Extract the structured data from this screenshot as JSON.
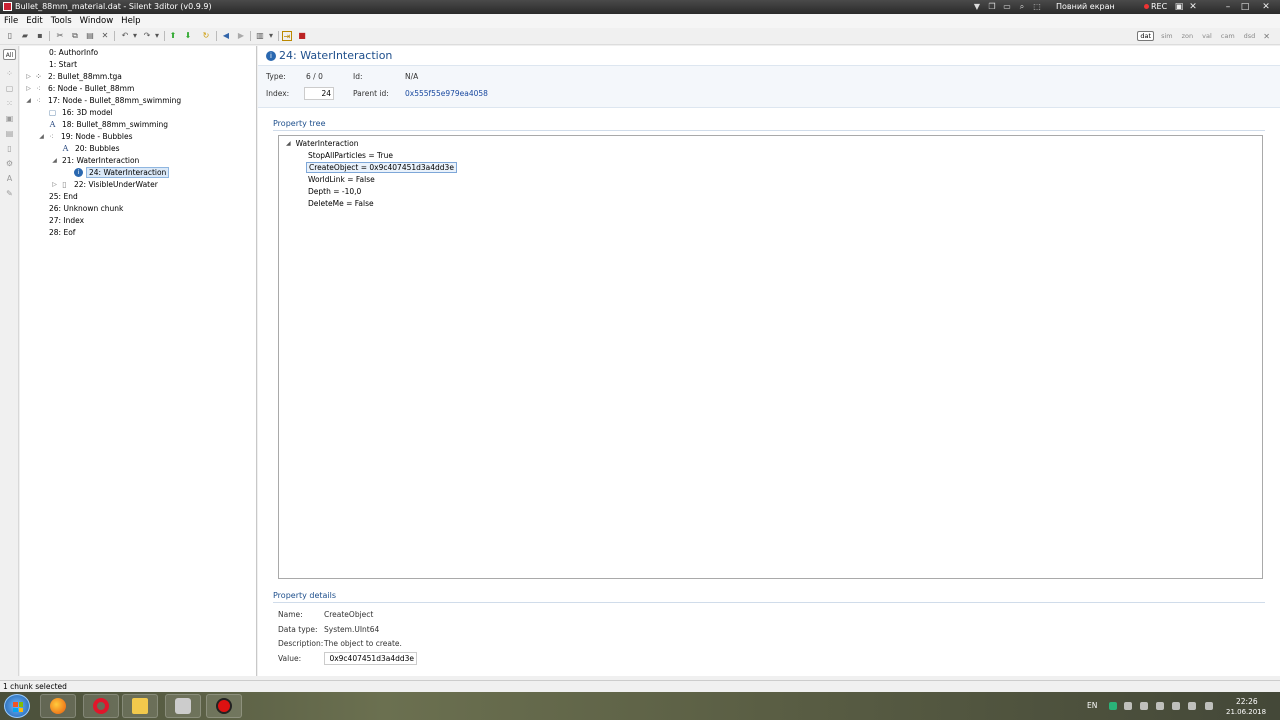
{
  "window": {
    "title": "Bullet_88mm_material.dat - Silent 3ditor (v0.9.9)",
    "fullscreen_label": "Повний екран",
    "rec_label": "REC"
  },
  "menu": [
    "File",
    "Edit",
    "Tools",
    "Window",
    "Help"
  ],
  "view_tabs": [
    {
      "label": "dat",
      "active": true
    },
    {
      "label": "sim",
      "active": false
    },
    {
      "label": "zon",
      "active": false
    },
    {
      "label": "val",
      "active": false
    },
    {
      "label": "cam",
      "active": false
    },
    {
      "label": "dsd",
      "active": false
    }
  ],
  "left_strip": {
    "all_label": "All"
  },
  "tree": [
    {
      "label": "0: AuthorInfo",
      "depth": 0,
      "expander": "",
      "icon": "none"
    },
    {
      "label": "1: Start",
      "depth": 0,
      "expander": "",
      "icon": "none"
    },
    {
      "label": "2: Bullet_88mm.tga",
      "depth": 0,
      "expander": "▷",
      "icon": "texture-icon"
    },
    {
      "label": "6: Node - Bullet_88mm",
      "depth": 0,
      "expander": "▷",
      "icon": "node-icon"
    },
    {
      "label": "17: Node - Bullet_88mm_swimming",
      "depth": 0,
      "expander": "◢",
      "icon": "node-icon"
    },
    {
      "label": "16: 3D model",
      "depth": 1,
      "expander": "",
      "icon": "model-icon"
    },
    {
      "label": "18: Bullet_88mm_swimming",
      "depth": 1,
      "expander": "",
      "icon": "text-icon"
    },
    {
      "label": "19: Node - Bubbles",
      "depth": 1,
      "expander": "◢",
      "icon": "node-icon"
    },
    {
      "label": "20: Bubbles",
      "depth": 2,
      "expander": "",
      "icon": "text-icon"
    },
    {
      "label": "21: WaterInteraction",
      "depth": 2,
      "expander": "◢",
      "icon": "none"
    },
    {
      "label": "24: WaterInteraction",
      "depth": 3,
      "expander": "",
      "icon": "water-icon",
      "selected": true
    },
    {
      "label": "22: VisibleUnderWater",
      "depth": 2,
      "expander": "▷",
      "icon": "none"
    },
    {
      "label": "25: End",
      "depth": 0,
      "expander": "",
      "icon": "none"
    },
    {
      "label": "26: Unknown chunk",
      "depth": 0,
      "expander": "",
      "icon": "none"
    },
    {
      "label": "27: Index",
      "depth": 0,
      "expander": "",
      "icon": "none"
    },
    {
      "label": "28: Eof",
      "depth": 0,
      "expander": "",
      "icon": "none"
    }
  ],
  "header": {
    "title": "24: WaterInteraction"
  },
  "info": {
    "type_label": "Type:",
    "type_value": "6 / 0",
    "id_label": "Id:",
    "id_value": "N/A",
    "index_label": "Index:",
    "index_value": "24",
    "parent_label": "Parent id:",
    "parent_value": "0x555f55e979ea4058"
  },
  "property_tree": {
    "title": "Property tree",
    "root": "WaterInteraction",
    "items": [
      {
        "label": "StopAllParticles = True",
        "selected": false
      },
      {
        "label": "CreateObject = 0x9c407451d3a4dd3e",
        "selected": true
      },
      {
        "label": "WorldLink = False",
        "selected": false
      },
      {
        "label": "Depth = -10,0",
        "selected": false
      },
      {
        "label": "DeleteMe = False",
        "selected": false
      }
    ]
  },
  "details": {
    "title": "Property details",
    "name_label": "Name:",
    "name_value": "CreateObject",
    "type_label": "Data type:",
    "type_value": "System.UInt64",
    "desc_label": "Description:",
    "desc_value": "The object to create.",
    "value_label": "Value:",
    "value_value": "0x9c407451d3a4dd3e"
  },
  "status": {
    "text": "1 chunk selected"
  },
  "taskbar": {
    "lang": "EN",
    "time": "22:26",
    "date": "21.06.2018"
  },
  "colors": {
    "accent": "#1e4f8c",
    "link": "#1a4aa0"
  }
}
